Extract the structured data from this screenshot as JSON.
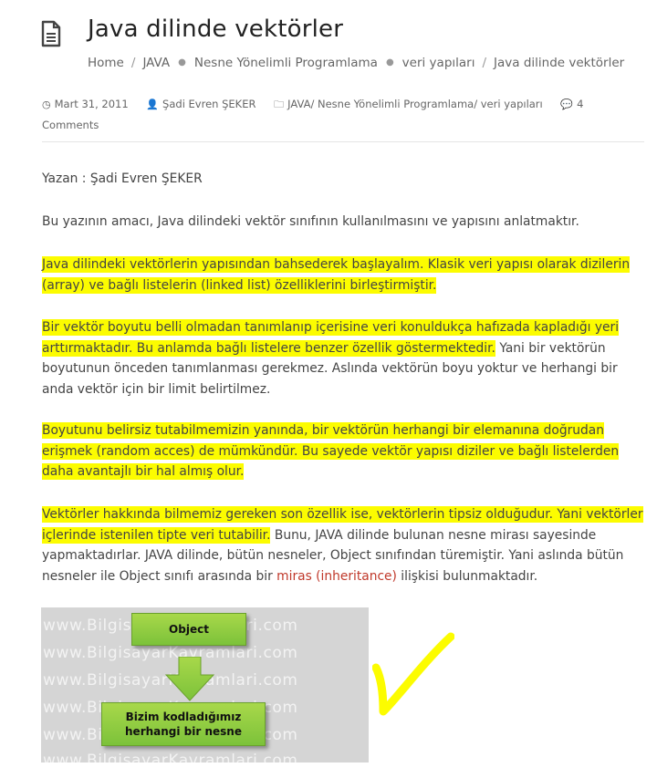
{
  "post": {
    "title": "Java dilinde vektörler",
    "breadcrumb": [
      "Home",
      "JAVA",
      "Nesne Yönelimli Programlama",
      "veri yapıları",
      "Java dilinde vektörler"
    ],
    "meta": {
      "date": "Mart 31, 2011",
      "author": "Şadi Evren ŞEKER",
      "categories": "JAVA/ Nesne Yönelimli Programlama/ veri yapıları",
      "comments": "4 Comments"
    },
    "author_line": "Yazan : Şadi Evren ŞEKER",
    "intro": "Bu yazının amacı, Java dilindeki vektör sınıfının kullanılmasını ve yapısını anlatmaktır.",
    "p1": "Java dilindeki vektörlerin yapısından bahsederek başlayalım. Klasik veri yapısı olarak dizilerin (array) ve bağlı listelerin (linked list) özelliklerini birleştirmiştir.",
    "p2_highlight": "Bir vektör boyutu belli olmadan tanımlanıp içerisine veri konuldukça hafızada kapladığı yeri arttırmaktadır. Bu anlamda bağlı listelere benzer özellik göstermektedir.",
    "p2_rest": " Yani bir vektörün boyutunun önceden tanımlanması gerekmez. Aslında vektörün boyu yoktur ve herhangi bir anda vektör için bir limit belirtilmez.",
    "p3": "Boyutunu belirsiz tutabilmemizin yanında, bir vektörün herhangi bir elemanına doğrudan erişmek (random acces) de mümkündür. Bu sayede vektör yapısı diziler ve bağlı listelerden daha avantajlı bir hal almış olur.",
    "p4_highlight": "Vektörler hakkında bilmemiz gereken son özellik ise, vektörlerin tipsiz olduğudur. Yani vektörler içlerinde istenilen tipte veri tutabilir.",
    "p4_rest_a": " Bunu, JAVA dilinde bulunan nesne mirası sayesinde yapmaktadırlar. JAVA dilinde, bütün nesneler, Object sınıfından türemiştir. Yani aslında bütün nesneler ile Object sınıfı arasında bir ",
    "p4_link": "miras (inheritance)",
    "p4_rest_b": " ilişkisi bulunmaktadır."
  },
  "diagram": {
    "watermark": "www.BilgisayarKavramlari.com",
    "top_box": "Object",
    "bottom_box": "Bizim kodladığımız herhangi bir nesne"
  },
  "colors": {
    "highlight": "#fcfc00",
    "box_green": "#8ccb3f",
    "link": "#c0392b"
  }
}
